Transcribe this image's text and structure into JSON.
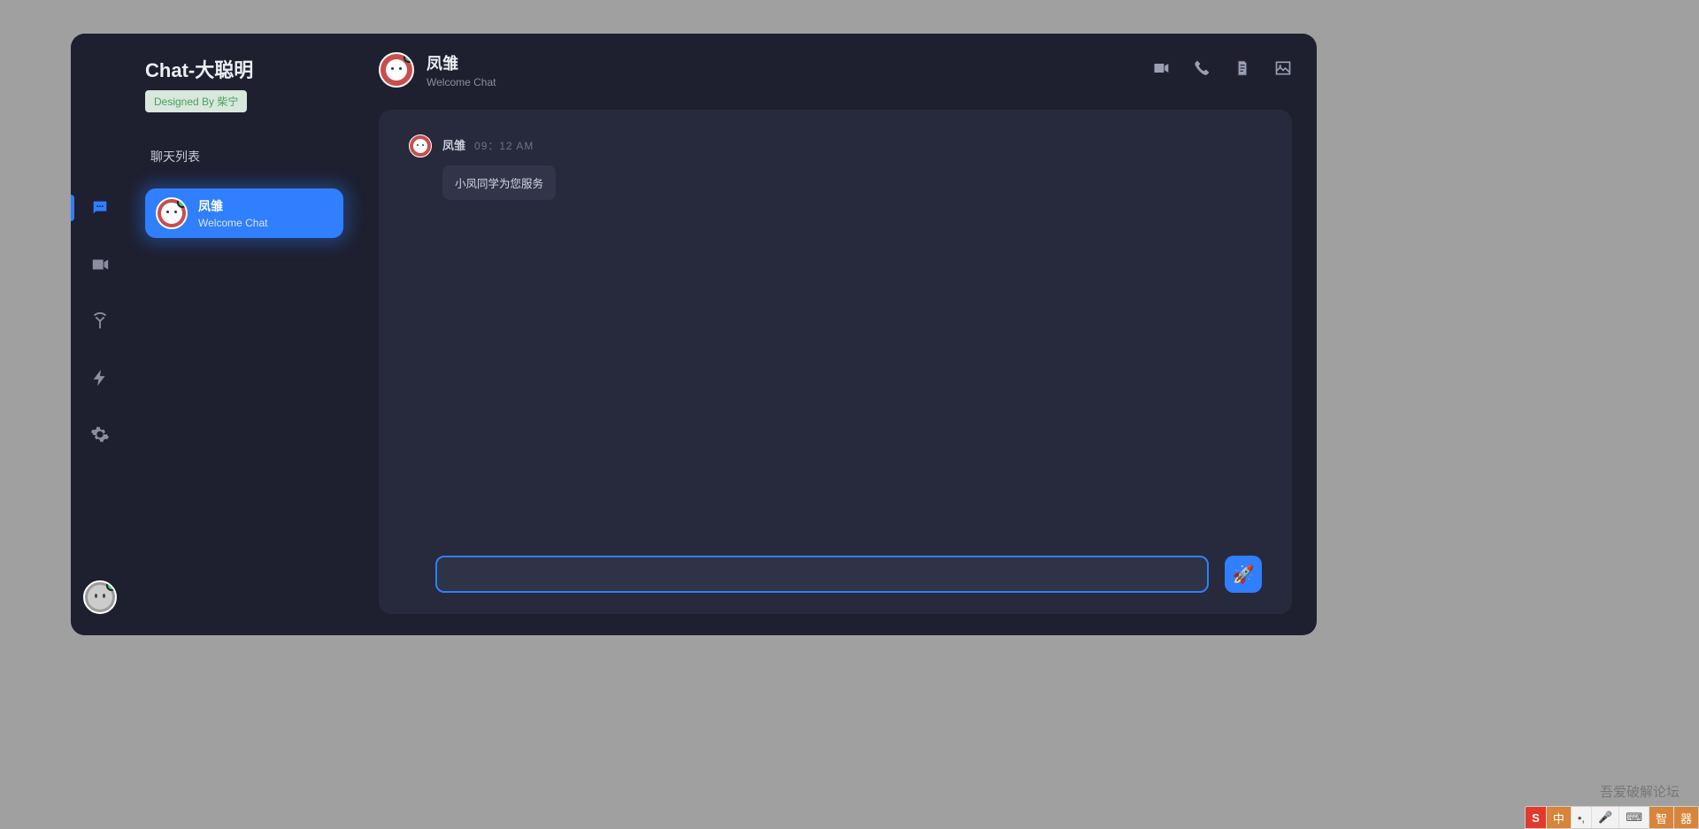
{
  "app": {
    "title": "Chat-大聪明",
    "badge": "Designed By 柴宁"
  },
  "sidebar": {
    "heading": "聊天列表",
    "conversations": [
      {
        "name": "凤雏",
        "subtitle": "Welcome Chat",
        "selected": true
      }
    ]
  },
  "header": {
    "name": "凤雏",
    "subtitle": "Welcome Chat"
  },
  "messages": [
    {
      "sender": "凤雏",
      "time": "09：12 AM",
      "text": "小凤同学为您服务"
    }
  ],
  "input": {
    "value": ""
  },
  "nav": {
    "items": [
      "chat",
      "video",
      "broadcast",
      "flash",
      "settings"
    ],
    "active": "chat"
  },
  "watermark": "吾爱破解论坛",
  "ime": {
    "logo": "S",
    "mode": "中",
    "punct": "•,",
    "mic": "🎤",
    "kbd": "⌨",
    "sym": "智",
    "tool": "器"
  },
  "colors": {
    "accent": "#2f7fff",
    "bg_window": "#1e2030",
    "bg_panel": "#272a3d",
    "online": "#3dd168"
  }
}
